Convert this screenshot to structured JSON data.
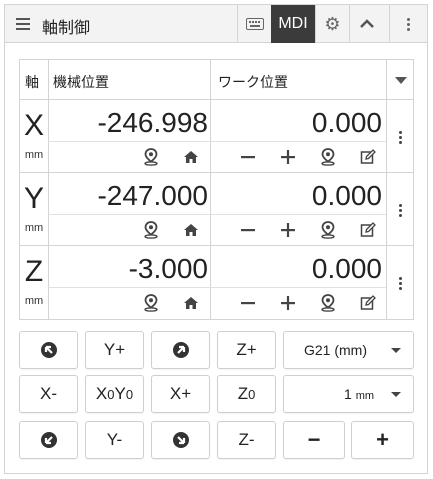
{
  "header": {
    "title": "軸制御",
    "mdi_label": "MDI",
    "icons": [
      "menu-icon",
      "keyboard-icon",
      "gear-icon",
      "chevron-up-icon",
      "more-vertical-icon"
    ]
  },
  "table": {
    "col_axis": "軸",
    "col_machine": "機械位置",
    "col_work": "ワーク位置",
    "rows": [
      {
        "axis": "X",
        "unit": "mm",
        "machine": "-246.998",
        "work": "0.000"
      },
      {
        "axis": "Y",
        "unit": "mm",
        "machine": "-247.000",
        "work": "0.000"
      },
      {
        "axis": "Z",
        "unit": "mm",
        "machine": "-3.000",
        "work": "0.000"
      }
    ],
    "row_icons": [
      "go-to-location-icon",
      "home-icon",
      "minus-icon",
      "plus-icon",
      "set-zero-location-icon",
      "edit-icon"
    ]
  },
  "jog": {
    "y_plus": "Y+",
    "z_plus": "Z+",
    "x_minus": "X-",
    "x0y0_x": "X",
    "x0y0_x0": "0",
    "x0y0_y": "Y",
    "x0y0_y0": "0",
    "x_plus": "X+",
    "z0_z": "Z",
    "z0_0": "0",
    "y_minus": "Y-",
    "z_minus": "Z-",
    "units_select": "G21 (mm)",
    "step_value": "1",
    "step_unit": "mm",
    "step_minus": "−",
    "step_plus": "+"
  }
}
